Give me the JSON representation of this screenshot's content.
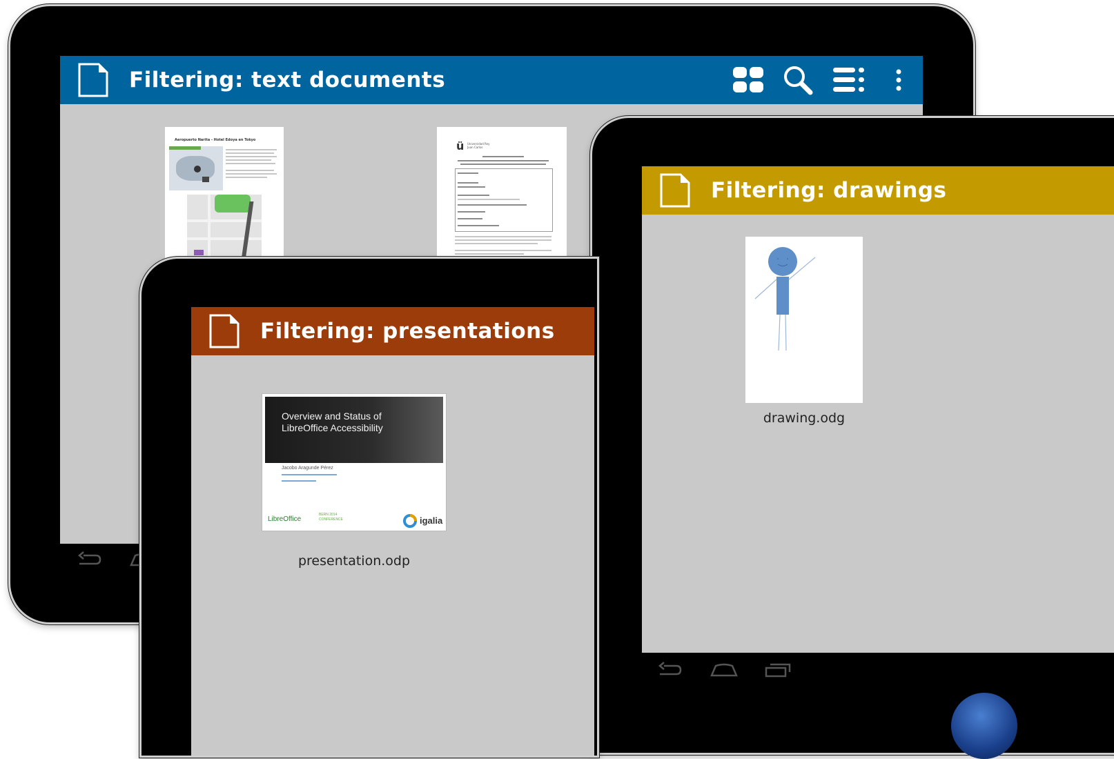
{
  "tablets": {
    "documents": {
      "title": "Filtering: text documents",
      "bar_color": "#00659e",
      "actions": [
        "grid-view-icon",
        "search-icon",
        "list-view-icon",
        "overflow-menu-icon"
      ],
      "files": [
        {
          "thumbnail_text": "Aeropuerto Narita - Hotel Edoya en Tokyo"
        },
        {
          "thumbnail_text": "Universidad Rey Juan Carlos"
        }
      ],
      "nav": [
        "back-icon",
        "home-icon"
      ]
    },
    "presentations": {
      "title": "Filtering: presentations",
      "bar_color": "#9c3c0a",
      "files": [
        {
          "name": "presentation.odp",
          "slide_title": "Overview and Status of LibreOffice Accessibility",
          "slide_author": "Jacobo Aragunde Pérez",
          "slide_logo_left": "LibreOffice",
          "slide_logo_mid": "BERN 2014 CONFERENCE",
          "slide_logo_right": "igalia"
        }
      ]
    },
    "drawings": {
      "title": "Filtering: drawings",
      "bar_color": "#c39a00",
      "files": [
        {
          "name": "drawing.odg"
        }
      ],
      "nav": [
        "back-icon",
        "home-icon",
        "recent-apps-icon"
      ]
    }
  }
}
